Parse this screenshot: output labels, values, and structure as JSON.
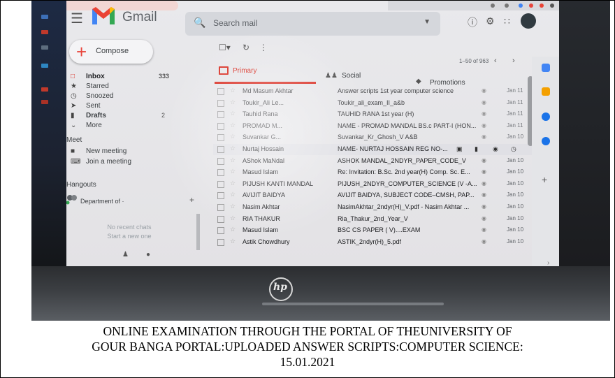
{
  "gmail": {
    "logo_text": "Gmail",
    "search_placeholder": "Search mail",
    "compose_label": "Compose",
    "nav": [
      {
        "label": "Inbox",
        "count": "333",
        "icon": "inbox-icon"
      },
      {
        "label": "Starred",
        "count": "",
        "icon": "star-icon"
      },
      {
        "label": "Snoozed",
        "count": "",
        "icon": "clock-icon"
      },
      {
        "label": "Sent",
        "count": "",
        "icon": "send-icon"
      },
      {
        "label": "Drafts",
        "count": "2",
        "icon": "draft-icon"
      },
      {
        "label": "More",
        "count": "",
        "icon": "chevron-down-icon"
      }
    ],
    "meet_title": "Meet",
    "meet_items": [
      {
        "label": "New meeting",
        "icon": "video-icon"
      },
      {
        "label": "Join a meeting",
        "icon": "keyboard-icon"
      }
    ],
    "hangouts_title": "Hangouts",
    "hangouts_user": "Department of ·",
    "hangouts_empty_1": "No recent chats",
    "hangouts_empty_2": "Start a new one",
    "pagination": "1–50 of 963",
    "tabs": {
      "primary": "Primary",
      "social": "Social",
      "promotions": "Promotions"
    },
    "messages": [
      {
        "sender": "Md Masum Akhtar",
        "subject": "Answer scripts 1st year computer science",
        "date": "Jan 11"
      },
      {
        "sender": "Toukir_Ali Le...",
        "subject": "Toukir_ali_exam_II_a&b",
        "date": "Jan 11"
      },
      {
        "sender": "Tauhid Rana",
        "subject": "TAUHID RANA 1st year (H)",
        "date": "Jan 11"
      },
      {
        "sender": "PROMAD M...",
        "subject": "NAME - PROMAD MANDAL BS.c PART-I (HON...",
        "date": "Jan 11"
      },
      {
        "sender": "Suvankar G...",
        "subject": "Suvankar_Kr_Ghosh_V A&B",
        "date": "Jan 10"
      },
      {
        "sender": "Nurtaj Hossain",
        "subject": "NAME- NURTAJ HOSSAIN REG NO-...",
        "date": ""
      },
      {
        "sender": "AShok MaNdal",
        "subject": "ASHOK MANDAL_2NDYR_PAPER_CODE_V",
        "date": "Jan 10"
      },
      {
        "sender": "Masud Islam",
        "subject": "Re: Invitation: B.Sc. 2nd year(H) Comp. Sc. E...",
        "date": "Jan 10"
      },
      {
        "sender": "PIJUSH KANTI MANDAL",
        "subject": "PIJUSH_2NDYR_COMPUTER_SCIENCE (V -A...",
        "date": "Jan 10"
      },
      {
        "sender": "AVIJIT BAIDYA",
        "subject": "AVIJIT BAIDYA, SUBJECT CODE–CMSH, PAP...",
        "date": "Jan 10"
      },
      {
        "sender": "Nasim Akhtar",
        "subject": "NasimAkhtar_2ndyr(H)_V.pdf - Nasim Akhtar ...",
        "date": "Jan 10"
      },
      {
        "sender": "RIA THAKUR",
        "subject": "Ria_Thakur_2nd_Year_V",
        "date": "Jan 10"
      },
      {
        "sender": "Masud Islam",
        "subject": "BSC CS PAPER ( V)....EXAM",
        "date": "Jan 10"
      },
      {
        "sender": "Astik Chowdhury",
        "subject": "ASTIK_2ndyr(H)_5.pdf",
        "date": "Jan 10"
      }
    ],
    "colors": {
      "accent_red": "#d93025",
      "inbox_highlight": "#f2d6d3",
      "gmail_blue": "#4285f4",
      "gmail_green": "#34a853",
      "gmail_yellow": "#fbbc04"
    }
  },
  "laptop": {
    "brand_mark": "hp"
  },
  "caption": {
    "line1": "ONLINE EXAMINATION THROUGH  THE PORTAL OF THEUNIVERSITY OF",
    "line2": "GOUR BANGA PORTAL:UPLOADED ANSWER SCRIPTS:COMPUTER SCIENCE:",
    "line3": "15.01.2021"
  }
}
